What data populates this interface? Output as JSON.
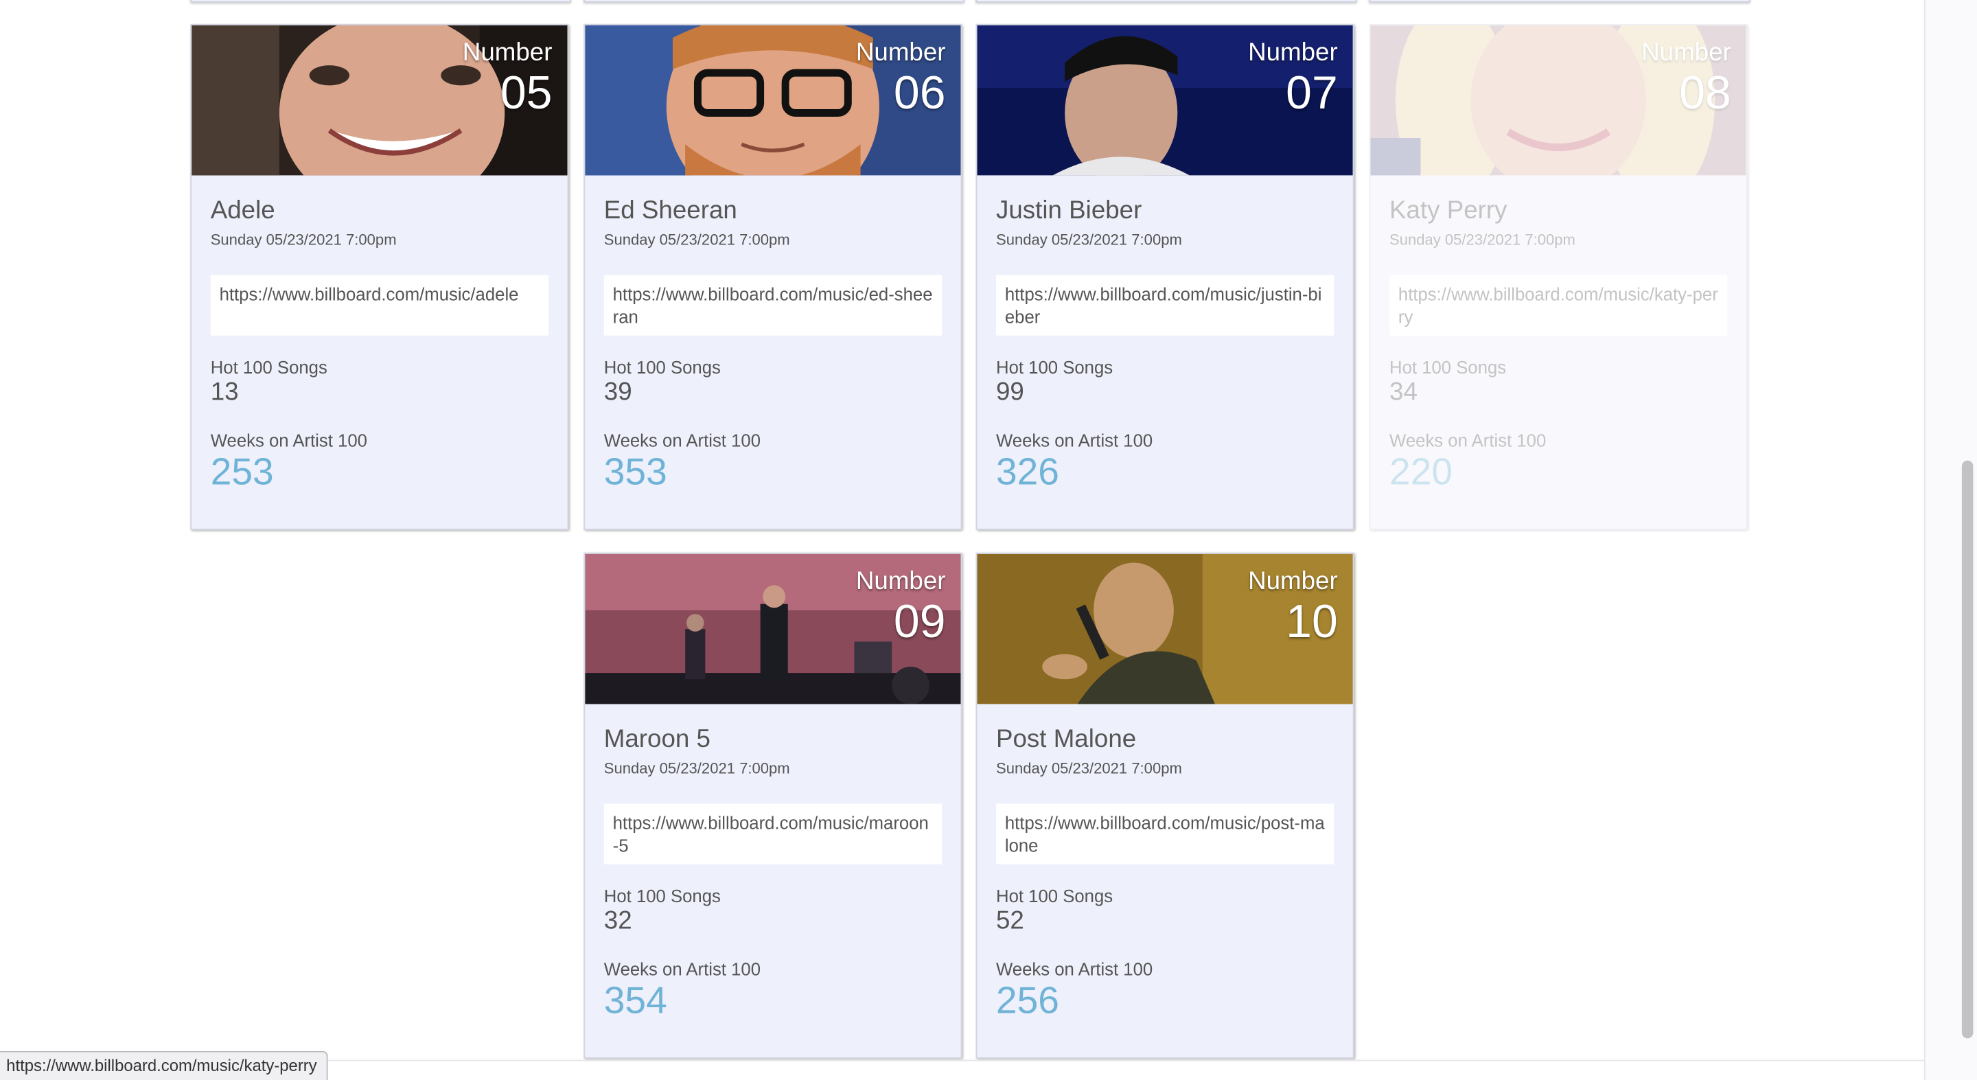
{
  "cards": [
    {
      "rank_label": "Number",
      "rank": "05",
      "name": "Adele",
      "date": "Sunday 05/23/2021 7:00pm",
      "url": "https://www.billboard.com/music/adele",
      "hot100_label": "Hot 100 Songs",
      "hot100": "13",
      "weeks_label": "Weeks on Artist 100",
      "weeks": "253",
      "photo_icon": "portrait-photo"
    },
    {
      "rank_label": "Number",
      "rank": "06",
      "name": "Ed Sheeran",
      "date": "Sunday 05/23/2021 7:00pm",
      "url": "https://www.billboard.com/music/ed-sheeran",
      "hot100_label": "Hot 100 Songs",
      "hot100": "39",
      "weeks_label": "Weeks on Artist 100",
      "weeks": "353",
      "photo_icon": "portrait-photo"
    },
    {
      "rank_label": "Number",
      "rank": "07",
      "name": "Justin Bieber",
      "date": "Sunday 05/23/2021 7:00pm",
      "url": "https://www.billboard.com/music/justin-bieber",
      "hot100_label": "Hot 100 Songs",
      "hot100": "99",
      "weeks_label": "Weeks on Artist 100",
      "weeks": "326",
      "photo_icon": "portrait-photo"
    },
    {
      "rank_label": "Number",
      "rank": "08",
      "name": "Katy Perry",
      "date": "Sunday 05/23/2021 7:00pm",
      "url": "https://www.billboard.com/music/katy-perry",
      "hot100_label": "Hot 100 Songs",
      "hot100": "34",
      "weeks_label": "Weeks on Artist 100",
      "weeks": "220",
      "photo_icon": "portrait-photo"
    },
    {
      "rank_label": "Number",
      "rank": "09",
      "name": "Maroon 5",
      "date": "Sunday 05/23/2021 7:00pm",
      "url": "https://www.billboard.com/music/maroon-5",
      "hot100_label": "Hot 100 Songs",
      "hot100": "32",
      "weeks_label": "Weeks on Artist 100",
      "weeks": "354",
      "photo_icon": "concert-photo"
    },
    {
      "rank_label": "Number",
      "rank": "10",
      "name": "Post Malone",
      "date": "Sunday 05/23/2021 7:00pm",
      "url": "https://www.billboard.com/music/post-malone",
      "hot100_label": "Hot 100 Songs",
      "hot100": "52",
      "weeks_label": "Weeks on Artist 100",
      "weeks": "256",
      "photo_icon": "concert-photo"
    }
  ],
  "status_bar": {
    "hover_url": "https://www.billboard.com/music/katy-perry"
  },
  "colors": {
    "card_background": "#eef0fb",
    "weeks_accent": "#6fb3d6",
    "text": "#555555"
  }
}
